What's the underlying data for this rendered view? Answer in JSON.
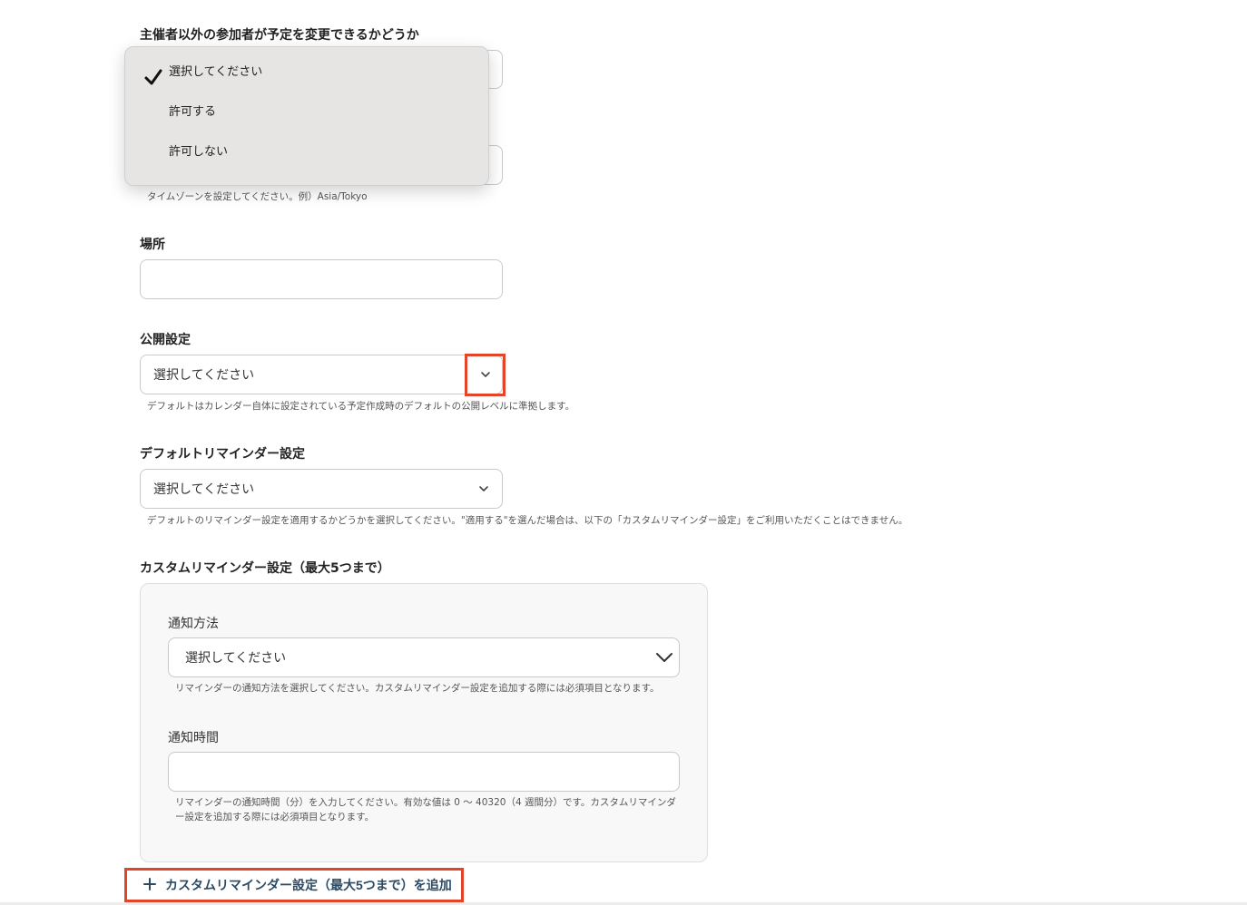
{
  "organizer_edit": {
    "label": "主催者以外の参加者が予定を変更できるかどうか",
    "dropdown_options": [
      "選択してください",
      "許可する",
      "許可しない"
    ],
    "selected_index": 0
  },
  "timezone": {
    "help": "タイムゾーンを設定してください。例）Asia/Tokyo"
  },
  "location": {
    "label": "場所",
    "value": ""
  },
  "visibility": {
    "label": "公開設定",
    "value": "選択してください",
    "help": "デフォルトはカレンダー自体に設定されている予定作成時のデフォルトの公開レベルに準拠します。"
  },
  "default_reminder": {
    "label": "デフォルトリマインダー設定",
    "value": "選択してください",
    "help": "デフォルトのリマインダー設定を適用するかどうかを選択してください。\"適用する\"を選んだ場合は、以下の「カスタムリマインダー設定」をご利用いただくことはできません。"
  },
  "custom_reminder": {
    "label": "カスタムリマインダー設定（最大5つまで）",
    "method": {
      "label": "通知方法",
      "value": "選択してください",
      "help": "リマインダーの通知方法を選択してください。カスタムリマインダー設定を追加する際には必須項目となります。"
    },
    "time": {
      "label": "通知時間",
      "value": "",
      "help": "リマインダーの通知時間（分）を入力してください。有効な値は 0 〜 40320（4 週間分）です。カスタムリマインダー設定を追加する際には必須項目となります。"
    },
    "add_button_label": "カスタムリマインダー設定（最大5つまで）を追加"
  },
  "colors": {
    "highlight": "#e2452a",
    "add_button_text": "#2b4a63"
  },
  "icons": {
    "check": "check-icon",
    "chevron": "chevron-down-icon",
    "plus": "plus-icon"
  }
}
